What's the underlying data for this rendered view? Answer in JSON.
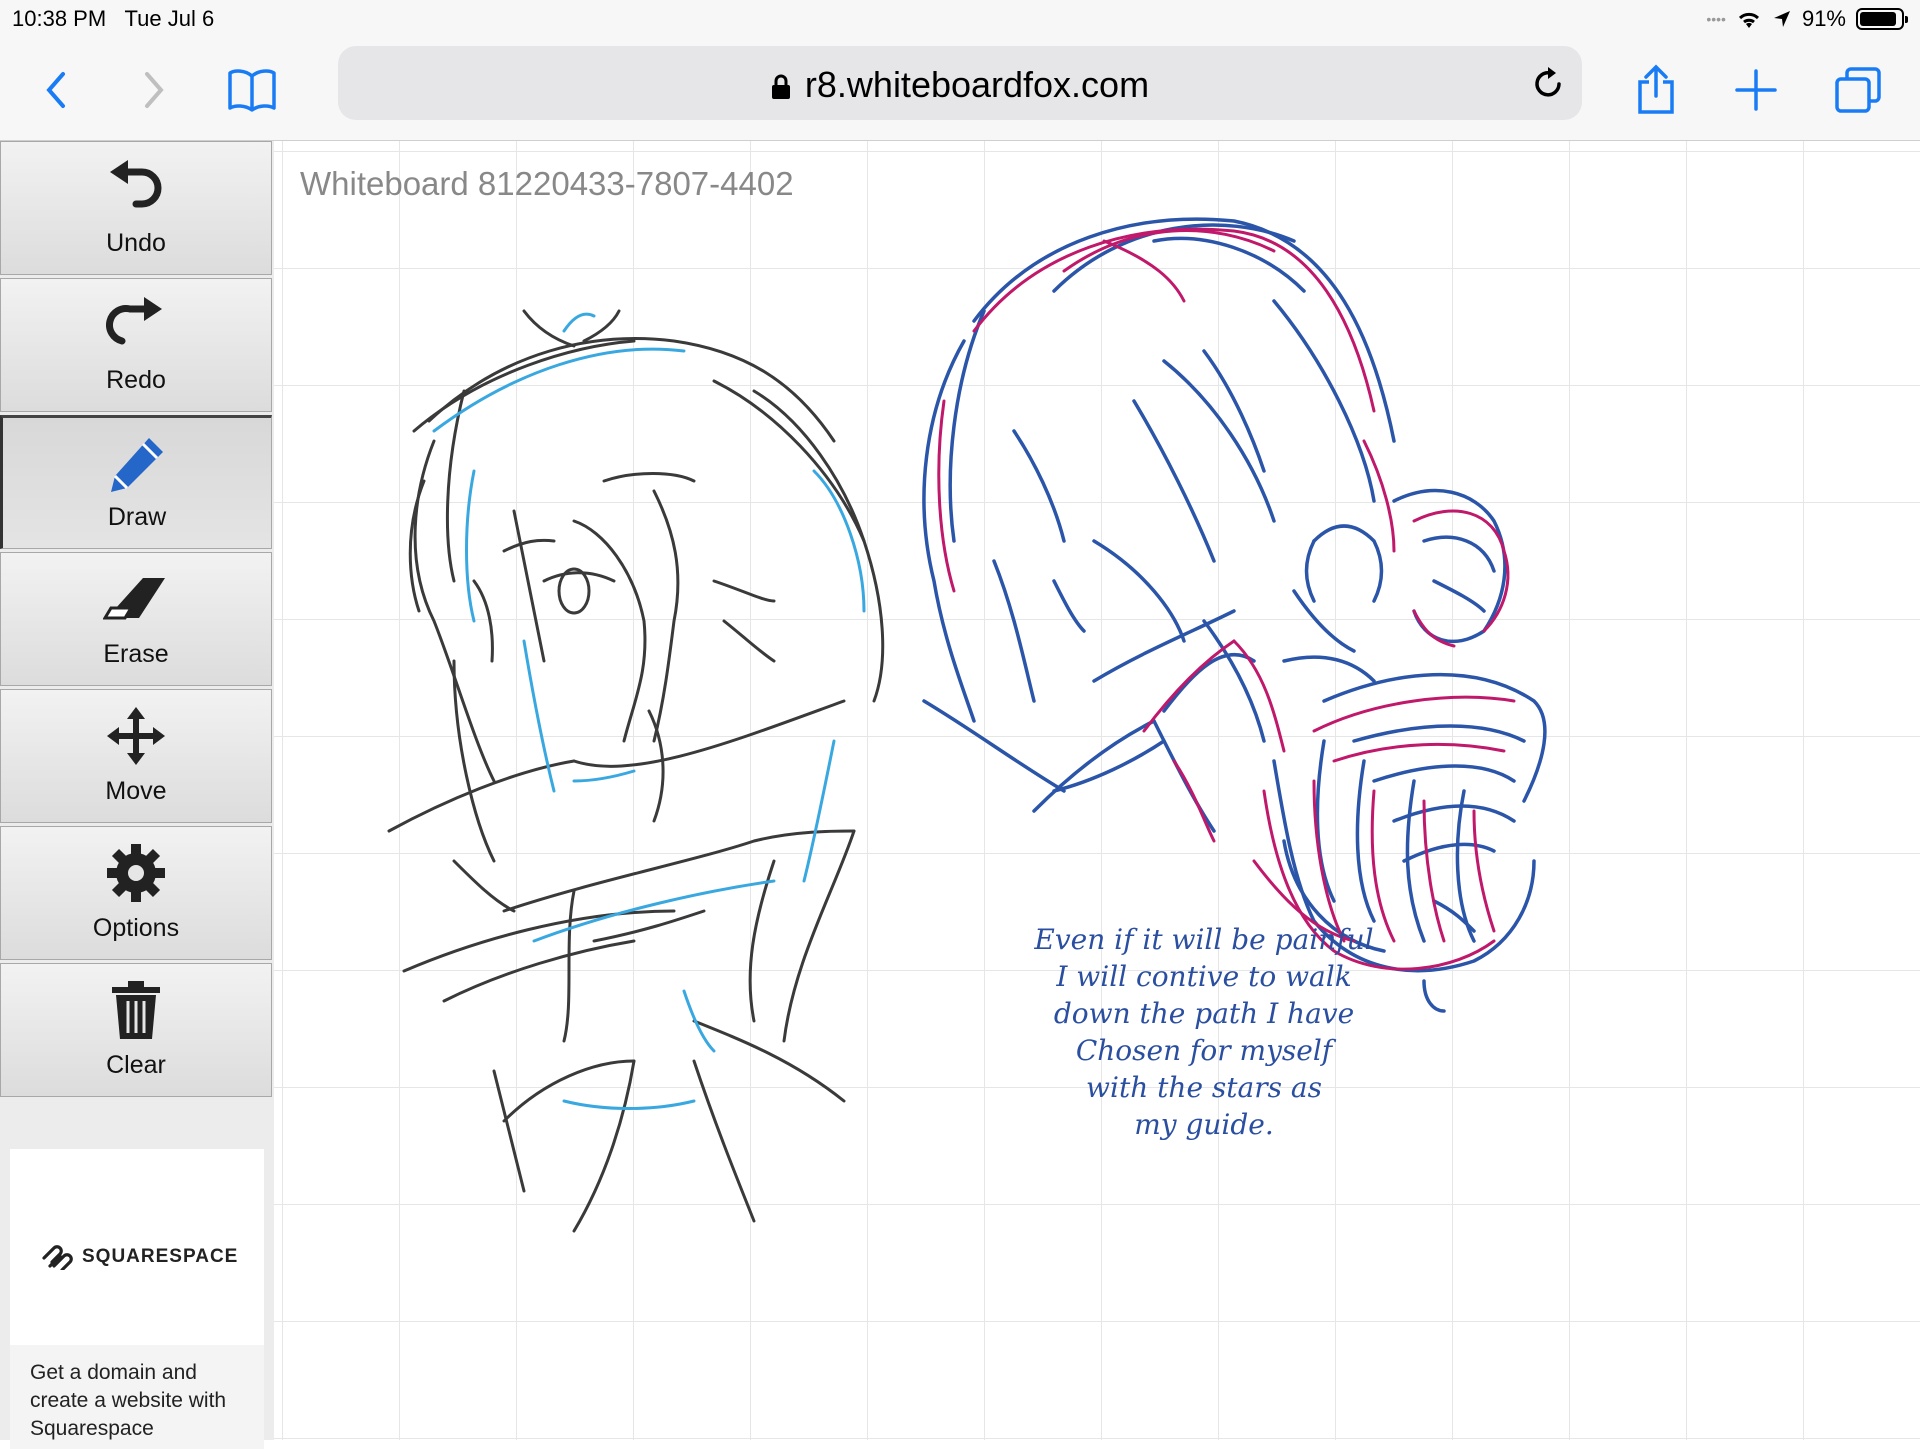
{
  "status_bar": {
    "time": "10:38 PM",
    "date": "Tue Jul 6",
    "battery": "91%",
    "battery_level": 0.91
  },
  "browser": {
    "url": "r8.whiteboardfox.com"
  },
  "tools": [
    {
      "label": "Undo",
      "icon": "undo-icon"
    },
    {
      "label": "Redo",
      "icon": "redo-icon"
    },
    {
      "label": "Draw",
      "icon": "pencil-icon",
      "active": true
    },
    {
      "label": "Erase",
      "icon": "eraser-icon"
    },
    {
      "label": "Move",
      "icon": "move-icon"
    },
    {
      "label": "Options",
      "icon": "gear-icon"
    },
    {
      "label": "Clear",
      "icon": "trash-icon"
    }
  ],
  "ad": {
    "brand": "SQUARESPACE",
    "text": "Get a domain and create a website with Squarespace"
  },
  "board": {
    "title": "Whiteboard 81220433-7807-4402",
    "note_lines": [
      "Even if it will be painful",
      "I will contive to walk",
      "down the path I have",
      "Chosen for myself",
      "with the stars as",
      "my guide."
    ],
    "ink_colors": {
      "black": "#3a3a3a",
      "light_blue": "#3aa8e0",
      "dark_blue": "#2b55a8",
      "magenta": "#c0186a"
    }
  }
}
